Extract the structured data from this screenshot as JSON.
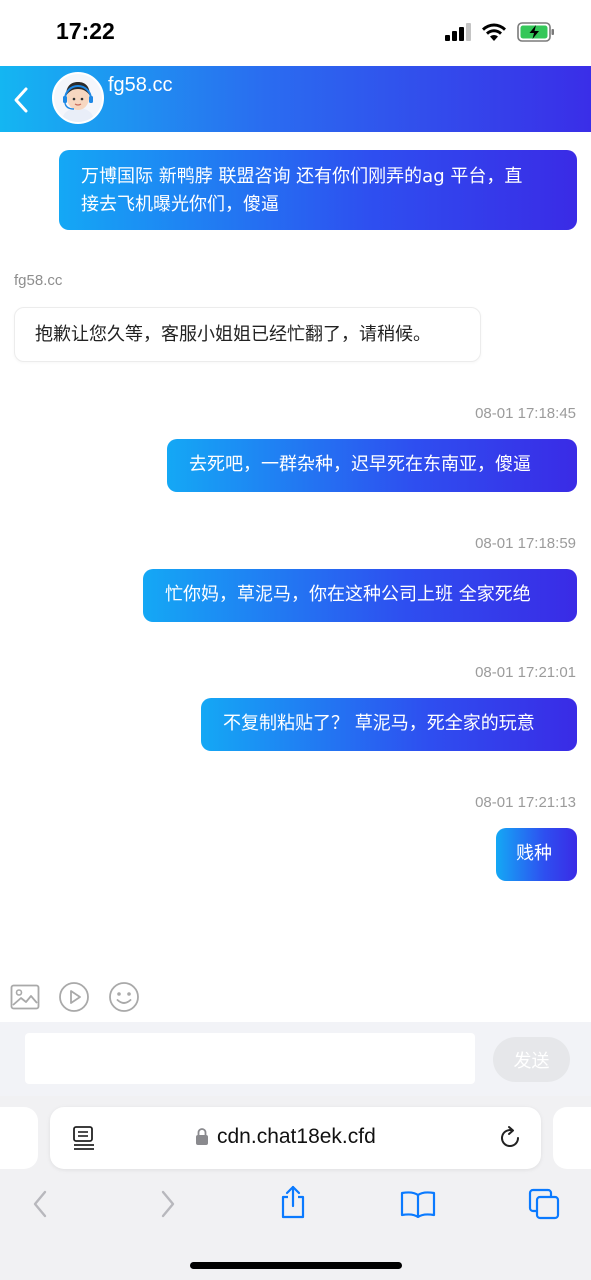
{
  "status_bar": {
    "time": "17:22",
    "signal_icon": "cellular-signal-icon",
    "wifi_icon": "wifi-icon",
    "battery_icon": "battery-charging-icon"
  },
  "header": {
    "title": "fg58.cc",
    "back_icon": "chevron-left-icon",
    "avatar_icon": "support-agent-avatar"
  },
  "messages": [
    {
      "direction": "outgoing",
      "text_line1": "万博国际 新鸭脖 联盟咨询 还有你们刚弄的ag 平台，直",
      "text_line2": "接去飞机曝光你们，傻逼"
    },
    {
      "direction": "incoming",
      "sender": "fg58.cc",
      "text": "抱歉让您久等，客服小姐姐已经忙翻了，请稍候。"
    },
    {
      "direction": "outgoing",
      "time": "08-01 17:18:45",
      "text": "去死吧，一群杂种，迟早死在东南亚，傻逼"
    },
    {
      "direction": "outgoing",
      "time": "08-01 17:18:59",
      "text": "忙你妈，草泥马，你在这种公司上班 全家死绝"
    },
    {
      "direction": "outgoing",
      "time": "08-01 17:21:01",
      "text": "不复制粘贴了？ 草泥马，死全家的玩意"
    },
    {
      "direction": "outgoing",
      "time": "08-01 17:21:13",
      "text": "贱种"
    }
  ],
  "toolbar": {
    "icons": [
      "image-icon",
      "video-play-icon",
      "emoji-icon"
    ]
  },
  "composer": {
    "placeholder": "",
    "send_label": "发送"
  },
  "browser": {
    "url": "cdn.chat18ek.cfd",
    "reader_icon": "reader-mode-icon",
    "lock_icon": "lock-icon",
    "reload_icon": "reload-icon",
    "nav_icons": [
      "back-arrow-icon",
      "forward-arrow-icon",
      "share-icon",
      "bookmarks-icon",
      "tabs-icon"
    ]
  },
  "colors": {
    "header_gradient_start": "#14b6f2",
    "header_gradient_end": "#3a2ee8",
    "ios_blue": "#0a7aff"
  }
}
